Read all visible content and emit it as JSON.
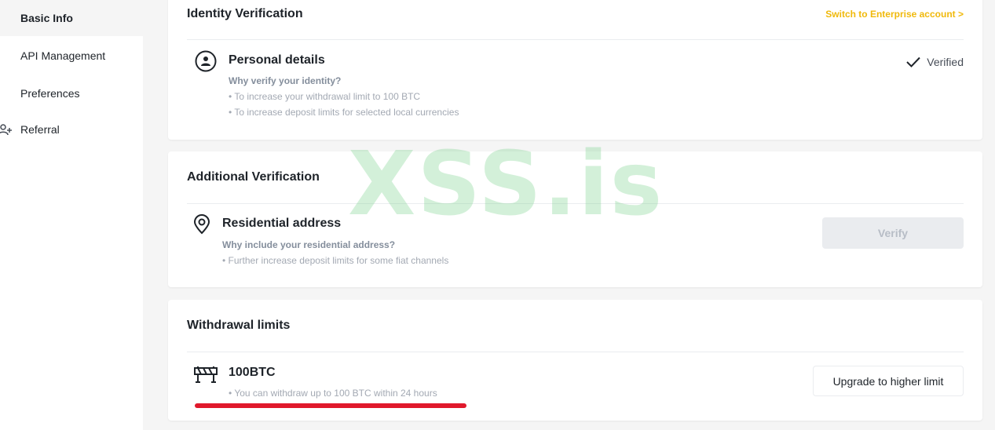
{
  "sidebar": {
    "items": [
      {
        "label": "Basic Info",
        "active": true
      },
      {
        "label": "API Management"
      },
      {
        "label": "Preferences"
      },
      {
        "label": "Referral",
        "icon": "add-user-icon"
      }
    ]
  },
  "identity": {
    "title": "Identity Verification",
    "enterprise_link": "Switch to Enterprise account >",
    "personal": {
      "icon": "user-circle-icon",
      "title": "Personal details",
      "question": "Why verify your identity?",
      "bullets": [
        "• To increase your withdrawal limit to 100 BTC",
        "• To increase deposit limits for selected local currencies"
      ],
      "status": "Verified",
      "status_icon": "checkmark-icon"
    }
  },
  "additional": {
    "title": "Additional Verification",
    "residential": {
      "icon": "location-pin-icon",
      "title": "Residential address",
      "question": "Why include your residential address?",
      "bullets": [
        "• Further increase deposit limits for some fiat channels"
      ],
      "button": "Verify"
    }
  },
  "withdrawal": {
    "title": "Withdrawal limits",
    "icon": "barrier-icon",
    "limit": "100BTC",
    "note": "• You can withdraw up to 100 BTC within 24 hours",
    "button": "Upgrade to higher limit"
  },
  "watermark": "XSS.is",
  "colors": {
    "accent": "#f0b90b",
    "underline": "#e0192c",
    "watermark": "#78d28c"
  }
}
